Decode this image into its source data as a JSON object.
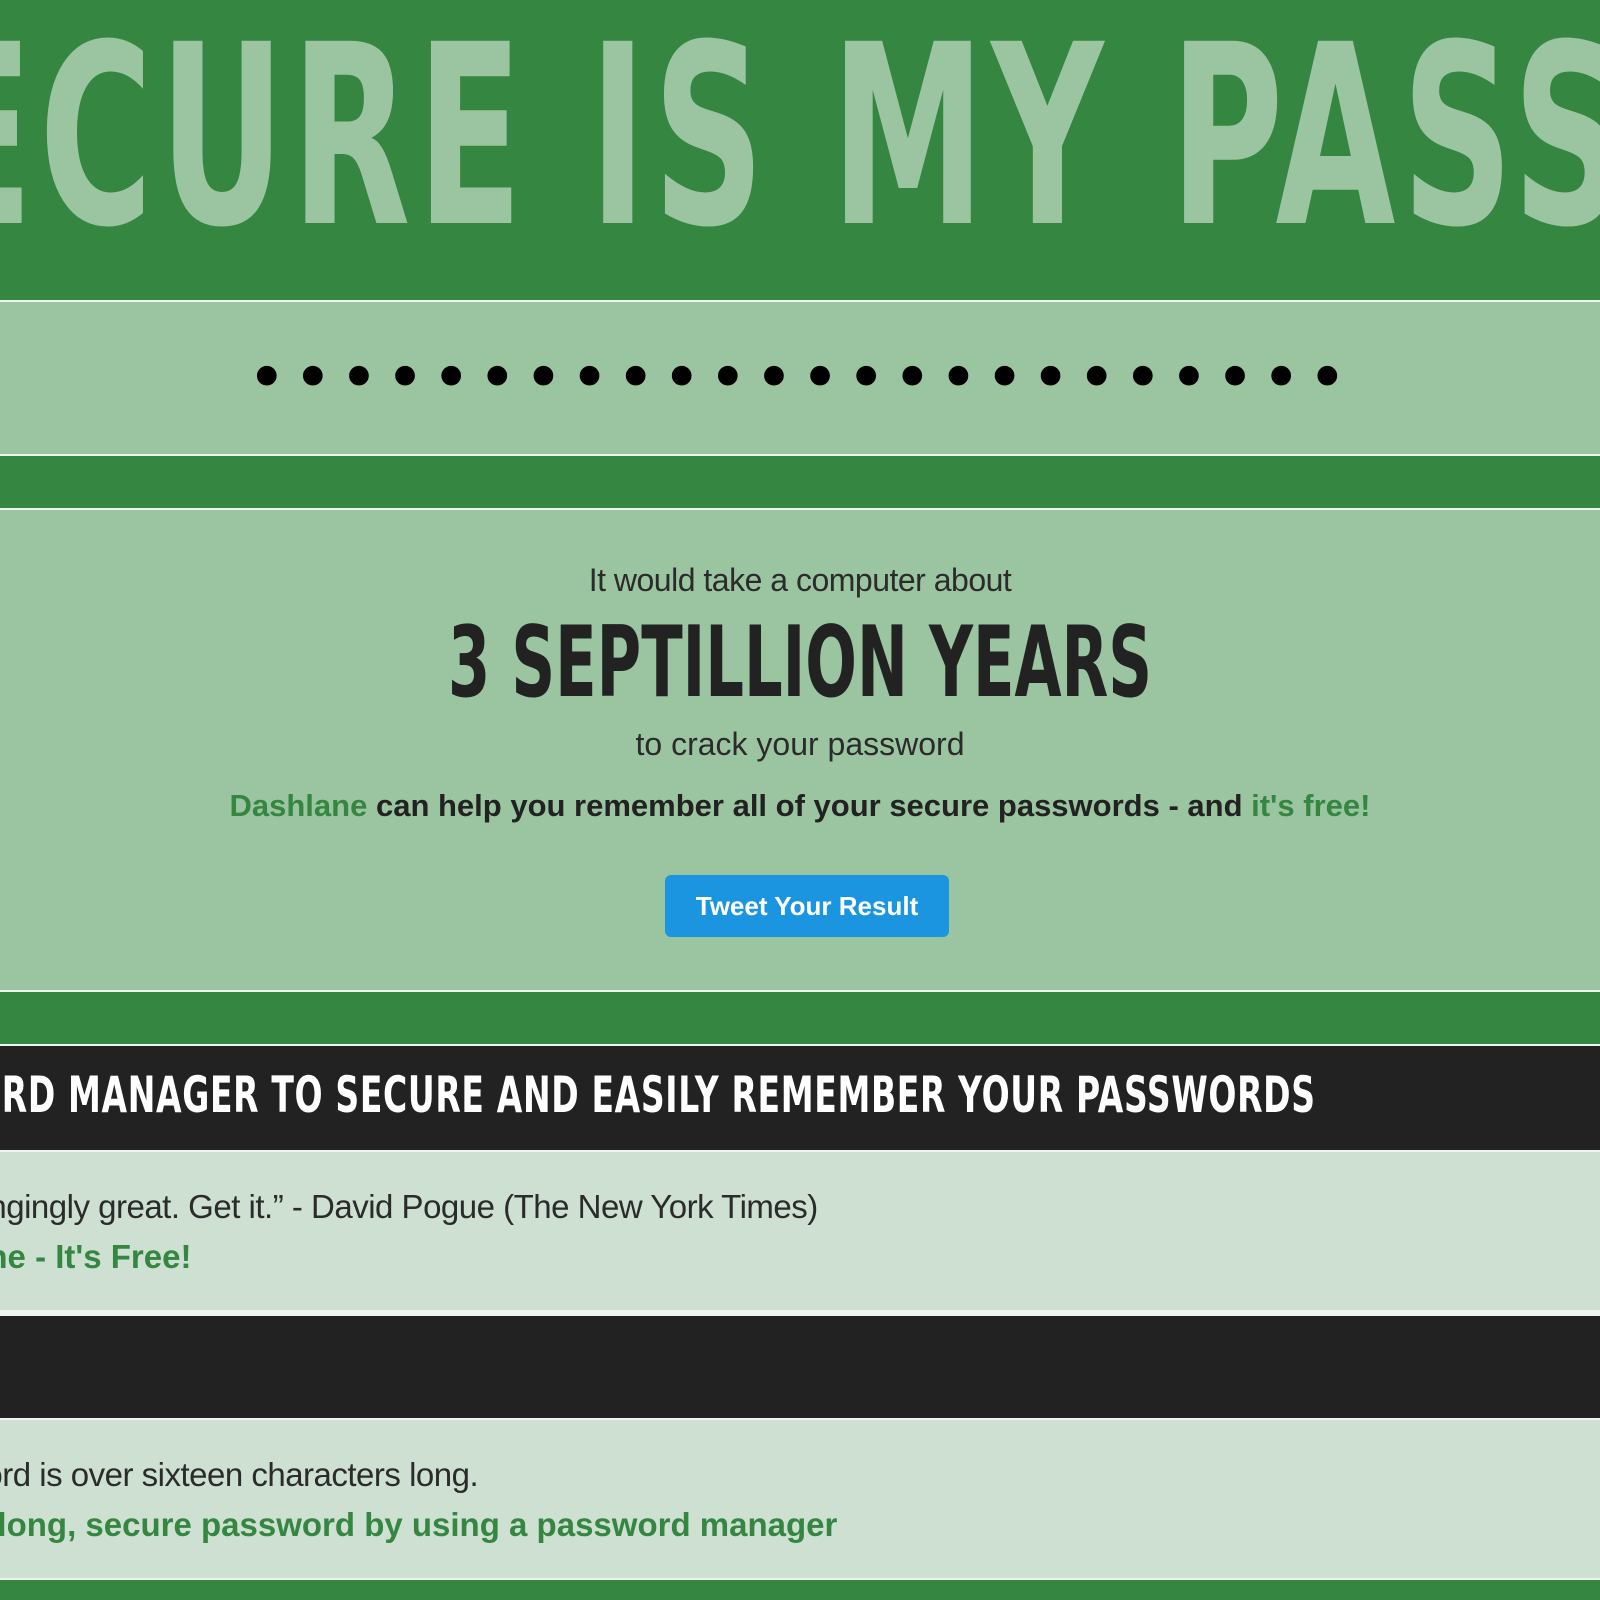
{
  "header": {
    "title": "HOW SECURE IS MY PASSWORD?"
  },
  "password_field": {
    "value": "••••••••••••••••••••••••"
  },
  "result": {
    "lead": "It would take a computer about",
    "duration": "3 SEPTILLION YEARS",
    "tail": "to crack your password",
    "pitch_brand": "Dashlane",
    "pitch_middle": " can help you remember all of your secure passwords - and ",
    "pitch_free": "it's free!",
    "tweet_button": "Tweet Your Result"
  },
  "banner": {
    "text": "USE A PASSWORD MANAGER TO SECURE AND EASILY REMEMBER YOUR PASSWORDS"
  },
  "quote_block": {
    "quote": "“Unchangingly great. Get it.” - David Pogue (The New York Times)",
    "cta": "Get Dashlane - It's Free!"
  },
  "tip_block": {
    "text": "Your password is over sixteen characters long.",
    "cta": "Remember your long, secure password by using a password manager"
  },
  "colors": {
    "primary_green": "#358640",
    "light_green": "#9bc5a1",
    "pale_green": "#cde0d1",
    "dark": "#222222",
    "twitter_blue": "#1b95e0"
  }
}
